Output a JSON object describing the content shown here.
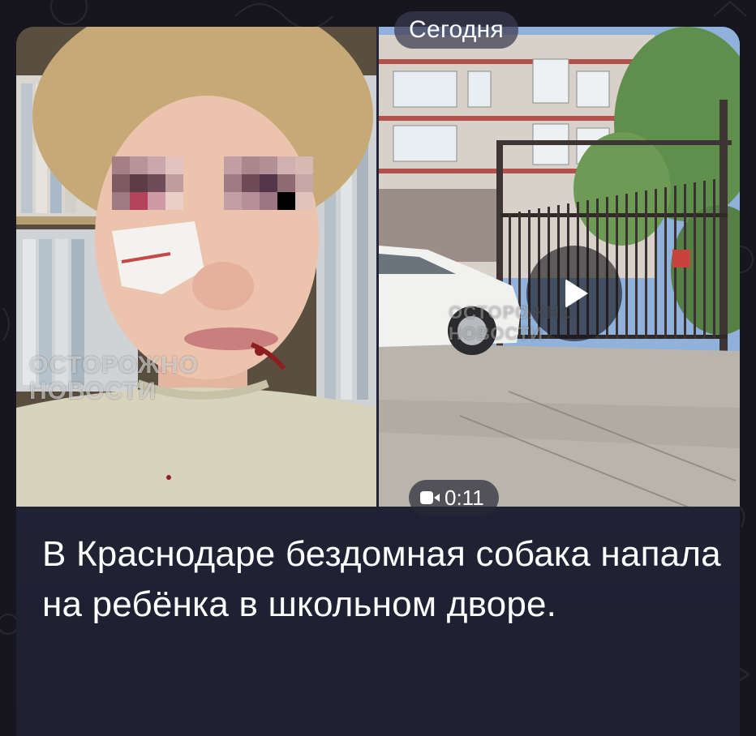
{
  "post": {
    "date_label": "Сегодня",
    "video_duration": "0:11",
    "headline": "В Краснодаре бездомная собака напала на ребёнка в школьном дворе.",
    "photo_watermark": "ОСТОРОЖНО\nНОВОСТИ",
    "video_watermark": "ОСТОРОЖНО\nНОВОСТИ"
  },
  "icons": {
    "play": "play-icon",
    "video": "video-camera-icon"
  },
  "colors": {
    "chat_background": "#17161f",
    "card_background": "#24243a",
    "text": "#ffffff"
  }
}
